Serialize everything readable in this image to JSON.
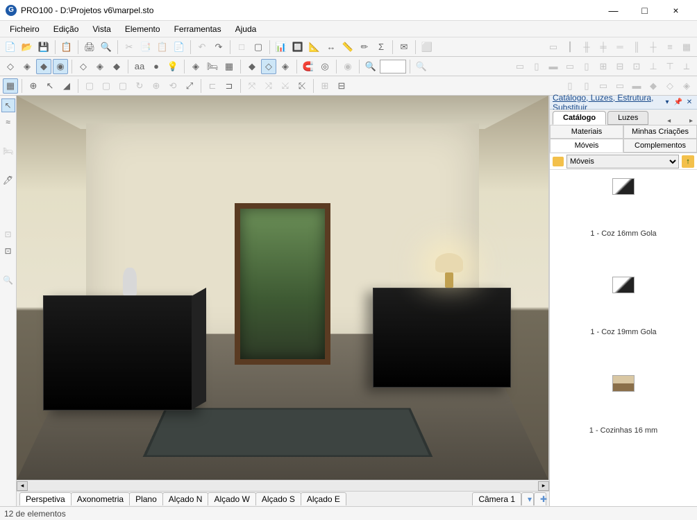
{
  "window": {
    "app_glyph": "G",
    "title": "PRO100 - D:\\Projetos v6\\marpel.sto",
    "minimize": "—",
    "maximize": "□",
    "close": "×"
  },
  "menu": {
    "items": [
      "Ficheiro",
      "Edição",
      "Vista",
      "Elemento",
      "Ferramentas",
      "Ajuda"
    ]
  },
  "toolbar_icons_row1": [
    "📄",
    "📂",
    "💾",
    "|",
    "📋",
    "|",
    "🖨",
    "🔍",
    "|",
    "✂",
    "📑",
    "📋",
    "📄",
    "|",
    "↶",
    "↷",
    "|",
    "□",
    "▢",
    "|",
    "📊",
    "🔲",
    "📐",
    "↔",
    "📏",
    "✏",
    "Σ",
    "|",
    "✉",
    "|",
    "⬜"
  ],
  "toolbar_icons_row1b": [
    "▭",
    "┃",
    "╫",
    "╪",
    "═",
    "║",
    "┼",
    "≡",
    "▦"
  ],
  "toolbar_icons_row2": [
    "◇",
    "◈",
    "◆",
    "◉",
    "|",
    "◇",
    "◈",
    "◆",
    "|",
    "aa",
    "●",
    "💡",
    "|",
    "◈",
    "🛏",
    "▦",
    "|",
    "◆",
    "◇",
    "◈",
    "|",
    "🧲",
    "◎",
    "|",
    "◉",
    "|",
    "🔍"
  ],
  "toolbar_icons_row2b": [
    "▭",
    "▯",
    "▬",
    "▭",
    "▯",
    "⊞",
    "⊟",
    "⊡",
    "⊥",
    "⊤",
    "⟂"
  ],
  "toolbar_icons_row3": [
    "▦",
    "|",
    "⊕",
    "↖",
    "◢",
    "|",
    "▢",
    "▢",
    "▢",
    "↻",
    "⊕",
    "⟲",
    "⤢",
    "|",
    "⊏",
    "⊐",
    "|",
    "⤧",
    "⤨",
    "⤩",
    "⤪",
    "|",
    "⊞",
    "⊟"
  ],
  "toolbar_icons_row3b": [
    "▯",
    "▯",
    "▭",
    "▭",
    "▬",
    "◆",
    "◇",
    "◈"
  ],
  "left_tools": [
    "↖",
    "≈",
    "",
    "🛏",
    "",
    "🖊",
    "",
    "",
    "",
    "⊡",
    "⊡",
    "",
    "🔍"
  ],
  "view_tabs": {
    "items": [
      "Perspetiva",
      "Axonometria",
      "Plano",
      "Alçado N",
      "Alçado  W",
      "Alçado  S",
      "Alçado  E"
    ],
    "active": 0,
    "camera": "Câmera 1",
    "dropdown": "▾",
    "add": "✚"
  },
  "right_panel": {
    "header_title": "Catálogo, Luzes, Estrutura, Substituir",
    "header_dropdown": "▾",
    "header_pin": "📌",
    "header_close": "✕",
    "main_tabs": [
      "Catálogo",
      "Luzes"
    ],
    "main_active": 0,
    "nav_left": "◂",
    "nav_right": "▸",
    "sub_tabs": [
      "Materiais",
      "Minhas Criações",
      "Móveis",
      "Complementos"
    ],
    "sub_active": 2,
    "path_selected": "Móveis",
    "path_options": [
      "Móveis"
    ],
    "up_glyph": "↑",
    "items": [
      {
        "label": "1 - Coz 16mm Gola",
        "thumb": "panel"
      },
      {
        "label": "1 - Coz 19mm Gola",
        "thumb": "panel"
      },
      {
        "label": "1 - Cozinhas 16 mm",
        "thumb": "kitchen"
      }
    ]
  },
  "status": {
    "text": "12 de elementos"
  },
  "scroll": {
    "left": "◂",
    "right": "▸"
  }
}
